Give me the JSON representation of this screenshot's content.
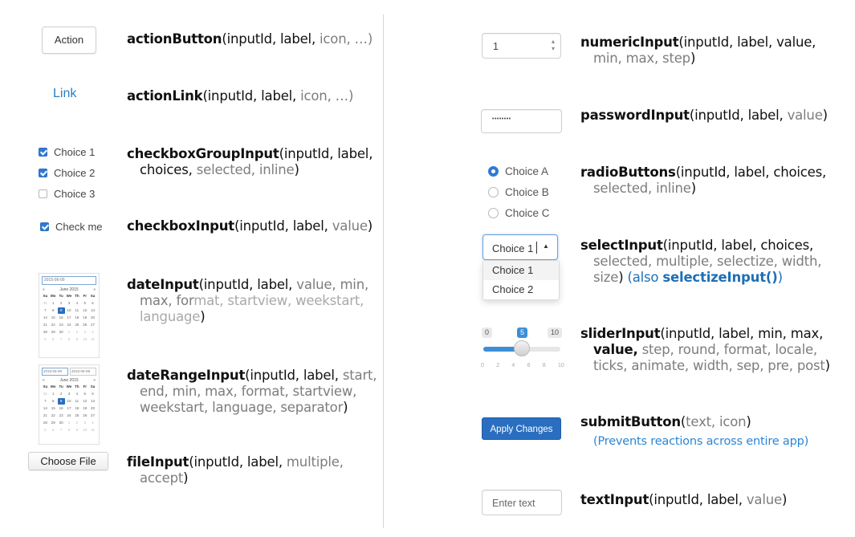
{
  "left": {
    "action_button": {
      "label": "Action",
      "fn": "actionButton",
      "req": "(inputId, label,",
      "opt": " icon, …)"
    },
    "action_link": {
      "label": "Link",
      "fn": "actionLink",
      "req": "(inputId, label,",
      "opt": " icon, …)"
    },
    "checkbox_group": {
      "items": [
        {
          "label": "Choice 1",
          "checked": true
        },
        {
          "label": "Choice 2",
          "checked": true
        },
        {
          "label": "Choice 3",
          "checked": false
        }
      ],
      "fn": "checkboxGroupInput",
      "req1": "(inputId, label,",
      "req2": "choices,",
      "opt2": " selected, inline",
      "close": ")"
    },
    "checkbox": {
      "label": "Check me",
      "checked": true,
      "fn": "checkboxInput",
      "req": "(inputId, label,",
      "opt": " value",
      "close": ")"
    },
    "date_input": {
      "value": "2015-06-09",
      "month": "June 2015",
      "fn": "dateInput",
      "req": "(inputId, label,",
      "opt1": " value, min,",
      "opt2a": "max, for",
      "opt2b": "mat, startview, weekstart,",
      "opt3": "language",
      "close": ")"
    },
    "date_range": {
      "start": "2015-06-09",
      "end": "2015-06-09",
      "month": "June 2015",
      "fn": "dateRangeInput",
      "req": "(inputId, label,",
      "opt1": " start,",
      "line2": "end, min, max, format, startview,",
      "line3": "weekstart, language, separator",
      "close": ")"
    },
    "file_input": {
      "label": "Choose File",
      "fn": "fileInput",
      "req": "(inputId, label,",
      "opt1": " multiple,",
      "opt2": "accept",
      "close": ")"
    }
  },
  "calendar": {
    "weekdays": [
      "Su",
      "Mo",
      "Tu",
      "We",
      "Th",
      "Fr",
      "Sa"
    ],
    "days": [
      "31",
      "1",
      "2",
      "3",
      "4",
      "5",
      "6",
      "7",
      "8",
      "9",
      "10",
      "11",
      "12",
      "13",
      "14",
      "15",
      "16",
      "17",
      "18",
      "19",
      "20",
      "21",
      "22",
      "23",
      "24",
      "25",
      "26",
      "27",
      "28",
      "29",
      "30",
      "1",
      "2",
      "3",
      "4",
      "5",
      "6",
      "7",
      "8",
      "9",
      "10",
      "11"
    ],
    "selected_index": 9
  },
  "right": {
    "numeric": {
      "value": "1",
      "fn": "numericInput",
      "req": "(inputId, label, value,",
      "opt2": "min, max, step",
      "close": ")"
    },
    "password": {
      "value": "••••••••",
      "fn": "passwordInput",
      "req": "(inputId, label,",
      "opt": " value",
      "close": ")"
    },
    "radio": {
      "items": [
        {
          "label": "Choice A",
          "checked": true
        },
        {
          "label": "Choice B",
          "checked": false
        },
        {
          "label": "Choice C",
          "checked": false
        }
      ],
      "fn": "radioButtons",
      "req": "(inputId, label, choices,",
      "opt2": "selected, inline",
      "close": ")"
    },
    "select": {
      "value": "Choice 1",
      "options": [
        "Choice 1",
        "Choice 2"
      ],
      "fn": "selectInput",
      "req": "(inputId, label, choices,",
      "opt2": "selected, multiple, selectize, width,",
      "opt3": "size",
      "close": ")",
      "also_pre": " (also ",
      "also_fn": "selectizeInput()",
      "also_post": ")"
    },
    "slider": {
      "min": "0",
      "max": "10",
      "value": "5",
      "fraction": 0.5,
      "ticks": [
        "0",
        "2",
        "4",
        "6",
        "8",
        "10"
      ],
      "fn": "sliderInput",
      "req": "(inputId, label, min, max,",
      "req2": "value,",
      "opt2": " step, round, format, locale,",
      "opt3": "ticks, animate, width, sep, pre, post",
      "close": ")"
    },
    "submit": {
      "label": "Apply Changes",
      "fn": "submitButton",
      "paren_open": "(",
      "opt": "text, icon",
      "close": ")",
      "note": "(Prevents reactions across entire app)"
    },
    "text": {
      "placeholder": "Enter text",
      "fn": "textInput",
      "req": "(inputId, label,",
      "opt": " value",
      "close": ")"
    }
  },
  "colors": {
    "accent": "#2f7ad6",
    "link": "#2a7fc0",
    "submit": "#2a6ec0"
  }
}
